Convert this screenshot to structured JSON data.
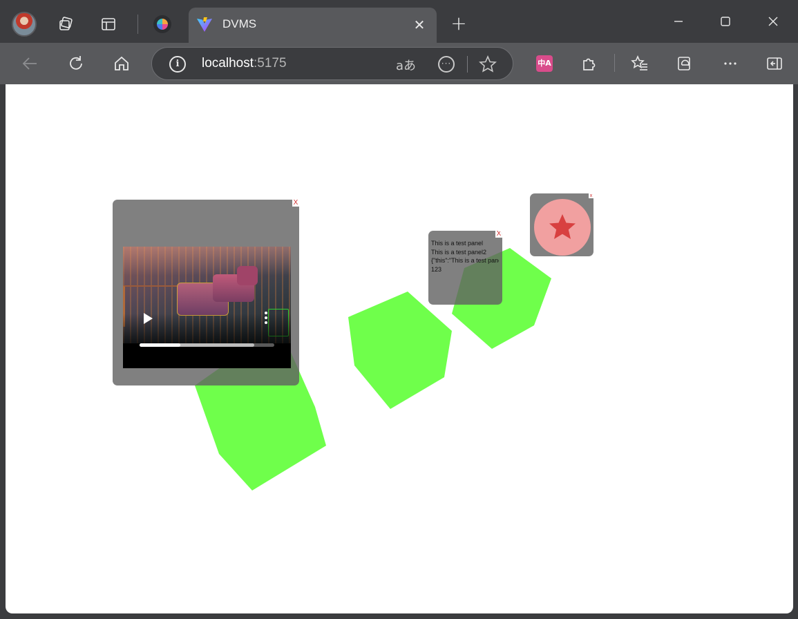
{
  "browser": {
    "tab": {
      "title": "DVMS"
    },
    "address": {
      "host": "localhost",
      "port": ":5175"
    },
    "address_text": {
      "read_aloud": "aあ"
    },
    "translate_badge": "中A"
  },
  "panels": {
    "video_panel": {
      "close_label": "X",
      "progress_played": 0.3,
      "progress_buffered": 0.85
    },
    "text_panel": {
      "close_label": "X",
      "lines": [
        "This is a test panel",
        "This is a test panel2",
        "{\"this\":\"This is a test panel\"}",
        "123"
      ]
    },
    "star_panel": {
      "close_label": "x"
    }
  },
  "colors": {
    "hexagon_fill": "#6fff4b",
    "panel_bg": "#606060",
    "star_fill": "#d84040",
    "star_circle": "#f1a0a0"
  }
}
